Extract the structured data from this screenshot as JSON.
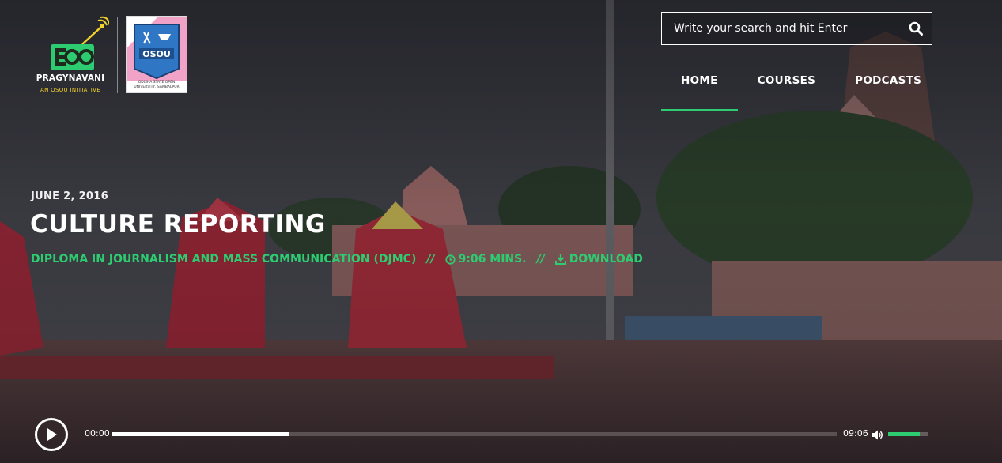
{
  "brand": {
    "name": "PRAGYNAVANI",
    "tagline": "AN OSOU INITIATIVE",
    "partner_caption": "ODISHA STATE OPEN UNIVERSITY, SAMBALPUR"
  },
  "search": {
    "placeholder": "Write your search and hit Enter"
  },
  "nav": [
    {
      "label": "HOME",
      "active": true
    },
    {
      "label": "COURSES",
      "active": false
    },
    {
      "label": "PODCASTS",
      "active": false
    }
  ],
  "episode": {
    "date": "JUNE 2, 2016",
    "title": "CULTURE REPORTING",
    "course": "DIPLOMA IN JOURNALISM AND MASS COMMUNICATION (DJMC)",
    "separator": "//",
    "duration": "9:06 MINS.",
    "download_label": "DOWNLOAD"
  },
  "player": {
    "current_time": "00:00",
    "total_time": "09:06",
    "progress": 0.243,
    "volume": 0.8
  },
  "colors": {
    "accent": "#2ecc71",
    "brand_yellow": "#f2d22a"
  },
  "icons": [
    "search-icon",
    "clock-icon",
    "download-icon",
    "play-icon",
    "volume-icon"
  ]
}
